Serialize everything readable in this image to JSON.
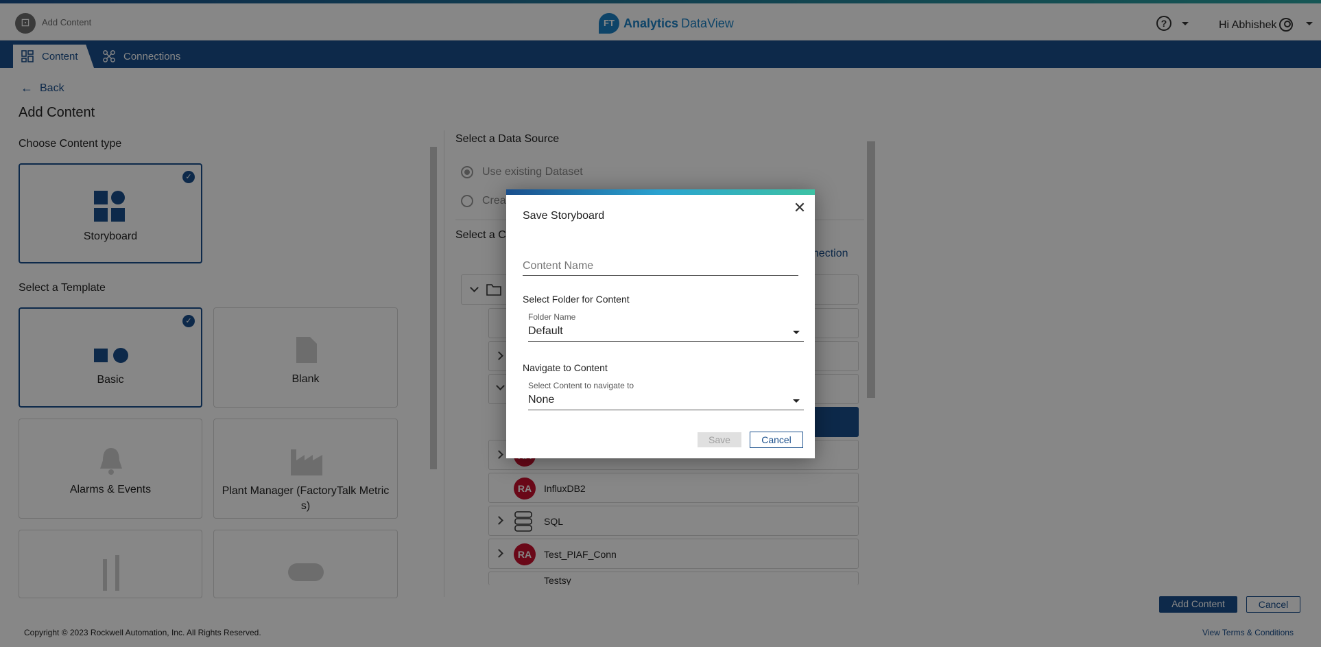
{
  "topbar": {
    "app_label": "Add Content",
    "brand_mark": "FT",
    "brand_name": "Analytics",
    "brand_sub": "DataView",
    "help_label": "?",
    "greeting": "Hi Abhishek"
  },
  "nav": {
    "tabs": [
      {
        "label": "Content",
        "icon": "grid-icon",
        "active": true
      },
      {
        "label": "Connections",
        "icon": "network-icon",
        "active": false
      }
    ]
  },
  "page": {
    "back_label": "Back",
    "title": "Add Content",
    "choose_type_label": "Choose Content type",
    "content_type": {
      "label": "Storyboard",
      "selected": true
    },
    "select_template_label": "Select a Template",
    "templates": [
      {
        "label": "Basic",
        "selected": true
      },
      {
        "label": "Blank",
        "selected": false
      },
      {
        "label": "Alarms & Events",
        "selected": false
      },
      {
        "label": "Plant Manager (FactoryTalk Metric s)",
        "selected": false
      }
    ],
    "data_source_label": "Select a Data Source",
    "radio_existing": "Use existing Dataset",
    "radio_create_partial": "Crea",
    "select_connection_partial": "Select a C",
    "new_connection_partial": "nnection",
    "tree_items": [
      {
        "label": "InfluxDB2"
      },
      {
        "label": "SQL"
      },
      {
        "label": "Test_PIAF_Conn"
      },
      {
        "label": "Testsy"
      }
    ],
    "add_content_button": "Add Content",
    "cancel_button": "Cancel"
  },
  "footer": {
    "copyright": "Copyright © 2023 Rockwell Automation, Inc. All Rights Reserved.",
    "terms": "View Terms & Conditions"
  },
  "modal": {
    "title": "Save Storyboard",
    "close_glyph": "✕",
    "content_name_placeholder": "Content Name",
    "folder_section": "Select Folder for Content",
    "folder_field_label": "Folder Name",
    "folder_value": "Default",
    "navigate_section": "Navigate to Content",
    "navigate_field_label": "Select Content to navigate to",
    "navigate_value": "None",
    "save_label": "Save",
    "cancel_label": "Cancel"
  },
  "colors": {
    "primary": "#1a4f8c",
    "brand": "#1b80c4",
    "ra_red": "#c8102e",
    "overlay": "rgba(0,0,0,0.47)"
  }
}
